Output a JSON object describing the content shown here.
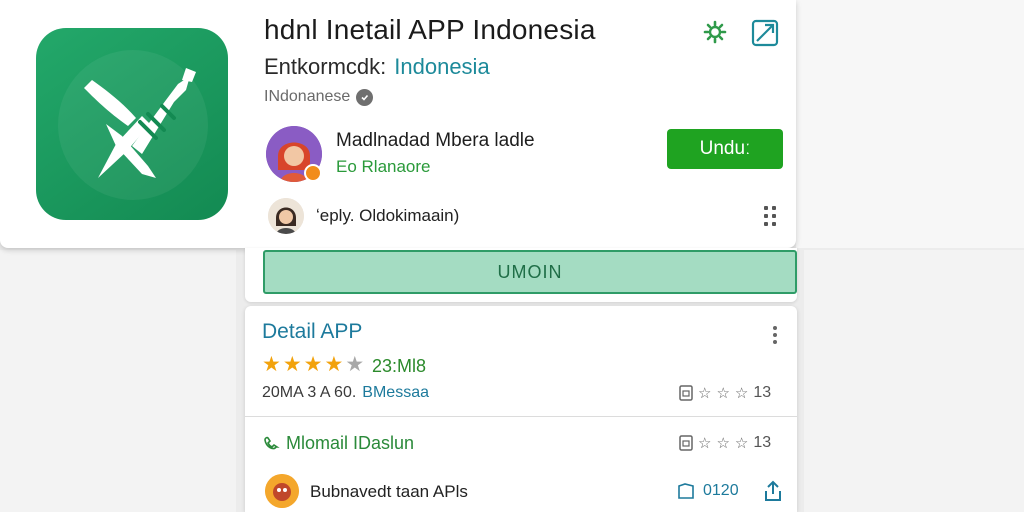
{
  "app": {
    "title": "hdnl  Inetail APP Indonesia",
    "developer": "Entkormcdk:",
    "developer_link": "Indonesia",
    "language": "INdonanese"
  },
  "publisher": {
    "name": "Madlnadad Mbera ladle",
    "subtitle": "Eo Rlanaore"
  },
  "install_label": "Unduː",
  "reply_text": "ʻeply. Oldokimaain)",
  "secondary_button_label": "UMOIN",
  "details": {
    "title": "Detail APP",
    "rating_value": "23:Ml8",
    "rating_stars": 4,
    "meta_left": "20MA  3 A 60.",
    "meta_accent": "BMessaa",
    "stats_row_1": "13",
    "stats_row_2": "13",
    "contact": "Mlomail IDaslun",
    "related_name": "Bubnavedt taan APls",
    "related_count": "0120"
  },
  "icons": {
    "header": [
      "gear-icon",
      "expand-icon"
    ],
    "menu": "grid-menu-icon"
  },
  "colors": {
    "brand_green": "#1fa321",
    "icon_green": "#1a9a5e",
    "link_teal": "#1d8a9a",
    "star_gold": "#f2a20c"
  }
}
